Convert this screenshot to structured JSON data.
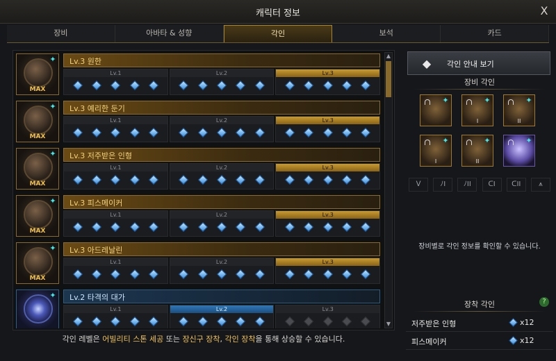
{
  "window": {
    "title": "캐릭터 정보",
    "close_glyph": "X"
  },
  "tabs": [
    {
      "label": "장비"
    },
    {
      "label": "아바타 & 성향"
    },
    {
      "label": "각인",
      "active": true
    },
    {
      "label": "보석"
    },
    {
      "label": "카드"
    }
  ],
  "level_headers": [
    "Lv.1",
    "Lv.2",
    "Lv.3"
  ],
  "engravings": [
    {
      "name": "Lv.3 원한",
      "badge": "MAX",
      "level": 3,
      "style": "gold"
    },
    {
      "name": "Lv.3 예리한 둔기",
      "badge": "MAX",
      "level": 3,
      "style": "gold"
    },
    {
      "name": "Lv.3 저주받은 인형",
      "badge": "MAX",
      "level": 3,
      "style": "gold"
    },
    {
      "name": "Lv.3 피스메이커",
      "badge": "MAX",
      "level": 3,
      "style": "gold"
    },
    {
      "name": "Lv.3 아드레날린",
      "badge": "MAX",
      "level": 3,
      "style": "gold"
    },
    {
      "name": "Lv.2 타격의 대가",
      "badge": "",
      "level": 2,
      "style": "blue"
    }
  ],
  "footer": {
    "prefix": "각인 레벨은 ",
    "hl1": "어빌리티 스톤 세공",
    "mid1": " 또는 ",
    "hl2": "장신구 장착",
    "mid2": ", ",
    "hl3": "각인 장착",
    "suffix": "을 통해 상승할 수 있습니다."
  },
  "right_panel": {
    "guide_button": "각인 안내 보기",
    "equip_title": "장비 각인",
    "equip_slots": [
      {
        "roman": "",
        "style": "gold"
      },
      {
        "roman": "I",
        "style": "gold"
      },
      {
        "roman": "II",
        "style": "gold"
      },
      {
        "roman": "I",
        "style": "gold"
      },
      {
        "roman": "II",
        "style": "gold"
      },
      {
        "roman": "",
        "style": "purple"
      }
    ],
    "filters": [
      "ᐯ",
      "ﾉI",
      "ﾉII",
      "ᑕI",
      "ᑕII",
      "⩚"
    ],
    "description": "장비별로 각인 정보를 확인할 수 있습니다.",
    "mount_title": "장착 각인",
    "help_glyph": "?",
    "mounted": [
      {
        "name": "저주받은 인형",
        "count": "x12"
      },
      {
        "name": "피스메이커",
        "count": "x12"
      }
    ]
  },
  "icons": {
    "close": "close-icon",
    "gear": "gear-icon",
    "guide": "book-icon",
    "help": "help-icon"
  },
  "colors": {
    "accent_gold": "#c89a32",
    "accent_blue": "#2f78b6",
    "gem_blue": "#3b8fe0",
    "highlight_text": "#f0c25a"
  }
}
